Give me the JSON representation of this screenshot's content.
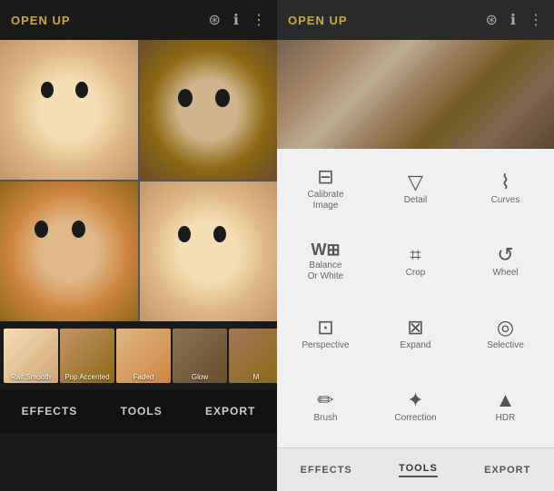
{
  "left": {
    "header": {
      "title": "OPEN UP",
      "icons": [
        "layers-icon",
        "info-icon",
        "more-icon"
      ]
    },
    "thumbnails": [
      {
        "label": "Rait Smooth"
      },
      {
        "label": "Pop Accented"
      },
      {
        "label": "Faded"
      },
      {
        "label": "Glow"
      },
      {
        "label": "M"
      }
    ],
    "bottom_bar": {
      "effects": "Effects",
      "tools": "TOOLS",
      "export": "EXPORT"
    }
  },
  "right": {
    "header": {
      "title": "OPEN UP",
      "icons": [
        "layers-icon",
        "info-icon",
        "more-icon"
      ]
    },
    "tools": [
      {
        "id": "calibrate",
        "icon": "⊟",
        "label": "Calibrate Image",
        "unicode": "≡"
      },
      {
        "id": "detail",
        "icon": "▽",
        "label": "Detail"
      },
      {
        "id": "curves",
        "icon": "⌇",
        "label": "Curves"
      },
      {
        "id": "balance",
        "icon": "⊞",
        "label": "Balance Or White"
      },
      {
        "id": "crop",
        "icon": "⌗",
        "label": "Crop"
      },
      {
        "id": "wheel",
        "icon": "↺",
        "label": "Wheel"
      },
      {
        "id": "perspective",
        "icon": "⊡",
        "label": "Perspective"
      },
      {
        "id": "expand",
        "icon": "⊡",
        "label": "Expand"
      },
      {
        "id": "selective",
        "icon": "◎",
        "label": "Selective"
      },
      {
        "id": "brush",
        "icon": "✏",
        "label": "Brush"
      },
      {
        "id": "correction",
        "icon": "✦",
        "label": "Correction"
      },
      {
        "id": "hdr",
        "icon": "▲",
        "label": "HDR"
      }
    ],
    "bottom_bar": {
      "effects": "EFFECTS",
      "tools": "TOOLS",
      "export": "EXPORT"
    }
  }
}
